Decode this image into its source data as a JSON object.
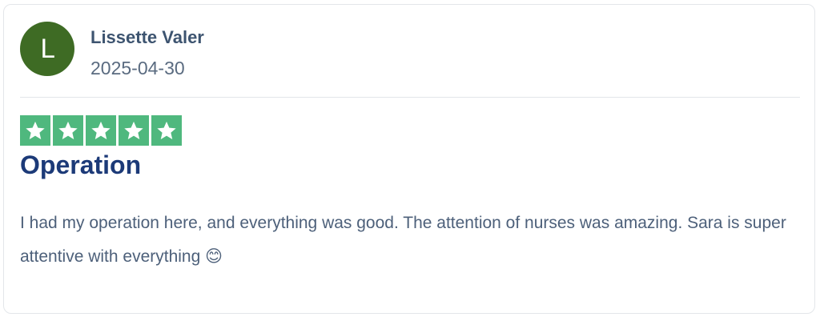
{
  "review": {
    "author_initial": "L",
    "author_name": "Lissette Valer",
    "date": "2025-04-30",
    "rating": 5,
    "rating_max": 5,
    "title": "Operation",
    "body": "I had my operation here, and everything was good. The attention of nurses was amazing. Sara is super attentive with everything 😊"
  },
  "colors": {
    "avatar_bg": "#3e6b24",
    "star_bg": "#4fb87e",
    "title": "#1c3a78"
  },
  "icons": {
    "star": "star-icon"
  }
}
